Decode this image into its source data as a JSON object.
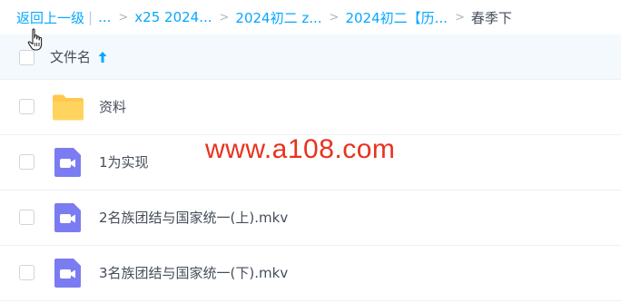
{
  "breadcrumb": {
    "back_label": "返回上一级",
    "items": [
      "...",
      "x25 2024...",
      "2024初二 z...",
      "2024初二【历...",
      "春季下"
    ]
  },
  "table": {
    "name_header": "文件名",
    "sort": "ascending",
    "rows": [
      {
        "name": "资料",
        "type": "folder-icon"
      },
      {
        "name": "1为实现",
        "type": "video-icon"
      },
      {
        "name": "2名族团结与国家统一(上).mkv",
        "type": "video-icon"
      },
      {
        "name": "3名族团结与国家统一(下).mkv",
        "type": "video-icon"
      }
    ]
  },
  "watermark": "www.a108.com",
  "colors": {
    "accent": "#06a7ff",
    "header_bg": "#f3f9fd",
    "folder": "#ffc94d",
    "video": "#7b7cf2",
    "watermark": "#e8321e"
  }
}
